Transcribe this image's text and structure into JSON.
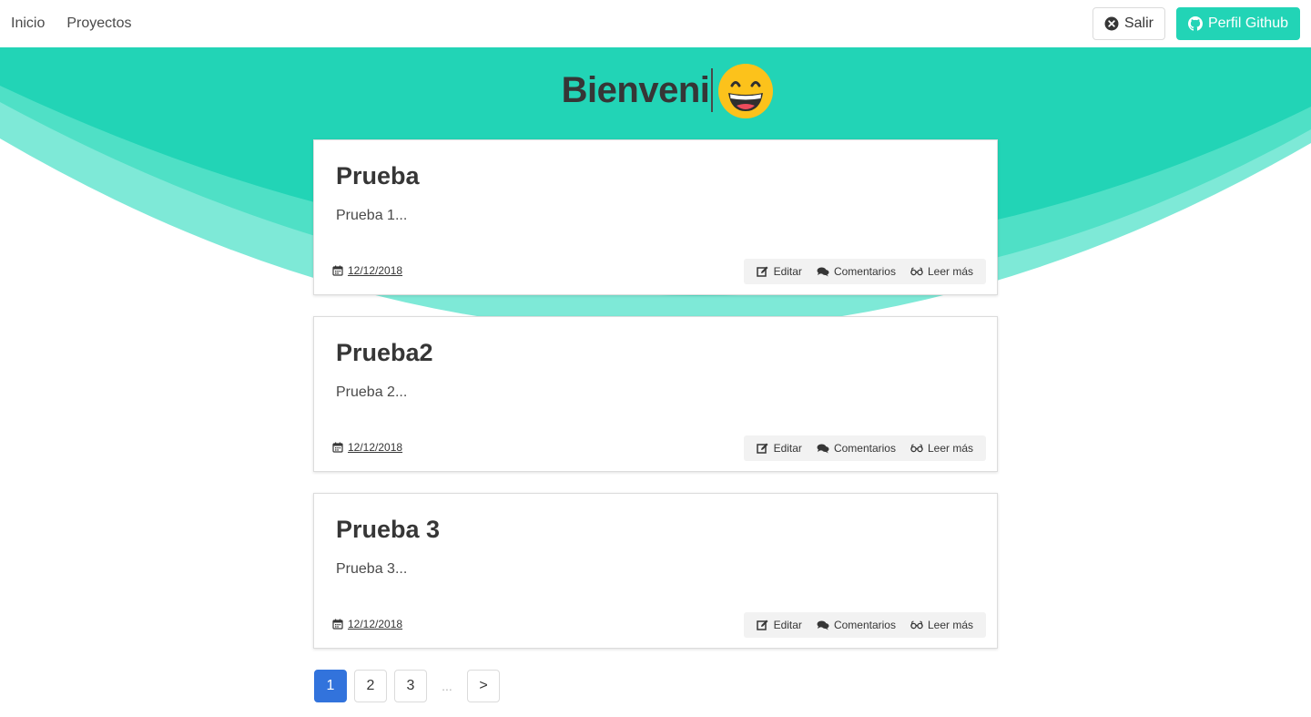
{
  "navbar": {
    "left_items": [
      {
        "label": "Inicio"
      },
      {
        "label": "Proyectos"
      }
    ],
    "logout_label": "Salir",
    "github_label": "Perfil Github"
  },
  "hero": {
    "typed_title": "Bienveni",
    "emoji": "grinning-face-with-smiling-eyes",
    "color": "#22d4b6"
  },
  "posts": [
    {
      "title": "Prueba",
      "excerpt": "Prueba 1...",
      "date": "12/12/2018",
      "actions": {
        "edit": "Editar",
        "comments": "Comentarios",
        "read_more": "Leer más"
      }
    },
    {
      "title": "Prueba2",
      "excerpt": "Prueba 2...",
      "date": "12/12/2018",
      "actions": {
        "edit": "Editar",
        "comments": "Comentarios",
        "read_more": "Leer más"
      }
    },
    {
      "title": "Prueba 3",
      "excerpt": "Prueba 3...",
      "date": "12/12/2018",
      "actions": {
        "edit": "Editar",
        "comments": "Comentarios",
        "read_more": "Leer más"
      }
    }
  ],
  "pagination": {
    "pages": [
      "1",
      "2",
      "3"
    ],
    "current": "1",
    "ellipsis": "...",
    "next": ">"
  },
  "colors": {
    "accent": "#22d4b6",
    "page_current": "#3273dc"
  },
  "icons": {
    "logout": "times-circle-icon",
    "github": "github-icon",
    "date": "calendar-icon",
    "edit": "edit-icon",
    "comments": "comments-icon",
    "read_more": "glasses-icon"
  }
}
